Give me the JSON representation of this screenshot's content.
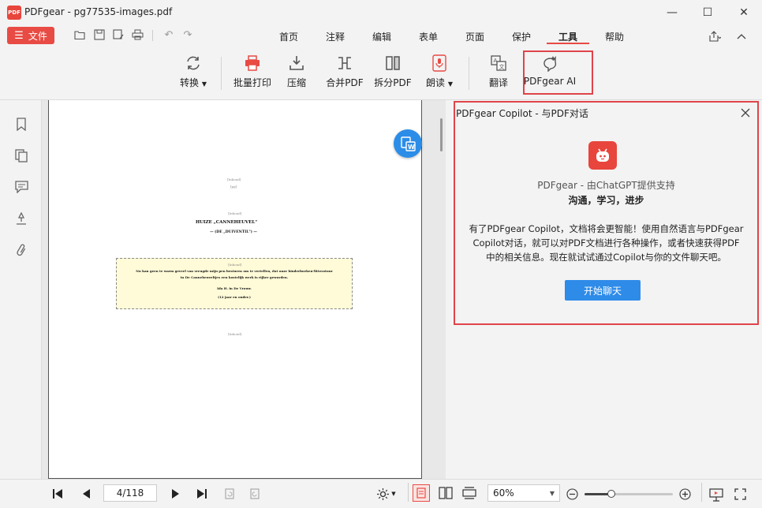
{
  "window": {
    "app_logo_text": "PDF",
    "title": "PDFgear - pg77535-images.pdf",
    "minimize_label": "—",
    "maximize_label": "☐",
    "close_label": "✕"
  },
  "menu": {
    "file_label": "文件",
    "items": [
      "首页",
      "注释",
      "编辑",
      "表单",
      "页面",
      "保护",
      "工具",
      "帮助"
    ],
    "active": "工具"
  },
  "toolbar": {
    "tools": [
      {
        "label": "转换",
        "icon": "convert-icon",
        "dropdown": true
      },
      {
        "label": "批量打印",
        "icon": "batch-print-icon"
      },
      {
        "label": "压缩",
        "icon": "compress-icon"
      },
      {
        "label": "合并PDF",
        "icon": "merge-pdf-icon"
      },
      {
        "label": "拆分PDF",
        "icon": "split-pdf-icon"
      },
      {
        "label": "朗读",
        "icon": "read-aloud-icon",
        "dropdown": true
      },
      {
        "label": "翻译",
        "icon": "translate-icon"
      },
      {
        "label": "PDFgear AI",
        "icon": "ai-icon"
      }
    ]
  },
  "document": {
    "tag1": "[Inhoud]",
    "tag2": "[Inhoud]",
    "tag3": "[Inhoud]",
    "tag4": "[Inhoud]",
    "tag5": "[Inhoud]",
    "tiny_page": "[Inh]",
    "tiny_page2": "[pg]",
    "heading": "HUIZE „CANNEHEUVEL\"",
    "subheading": "— (DE „DUIVENTIL\") —",
    "quote_line1": "Nu kan geen te warm geveel van vreugde mijn pen besturen om te vertellen, dat onze kinderboeken-litteratuur",
    "quote_line2": "in De Canneheuveltjes een kostelijk werk is rijker geworden.",
    "quote_source": "Ida H. in De Vrouw.",
    "quote_age": "(12 jaar en ouder.)"
  },
  "copilot": {
    "title": "PDFgear Copilot - 与PDF对话",
    "subtitle": "PDFgear - 由ChatGPT提供支持",
    "tagline": "沟通，学习，进步",
    "description_line1": "有了PDFgear Copilot，文档将会更智能！使用自然语言与PDFgear",
    "description_line2": "Copilot对话，就可以对PDF文档进行各种操作，或者快速获得PDF",
    "description_line3": "中的相关信息。现在就试试通过Copilot与你的文件聊天吧。",
    "start_button": "开始聊天",
    "brand_color": "#e8453c"
  },
  "bottom": {
    "page_value": "4/118",
    "zoom_value": "60%",
    "zoom_level": 0.3
  },
  "colors": {
    "accent": "#e84b44",
    "highlight": "#e0434a",
    "button_blue": "#2e8be8"
  }
}
